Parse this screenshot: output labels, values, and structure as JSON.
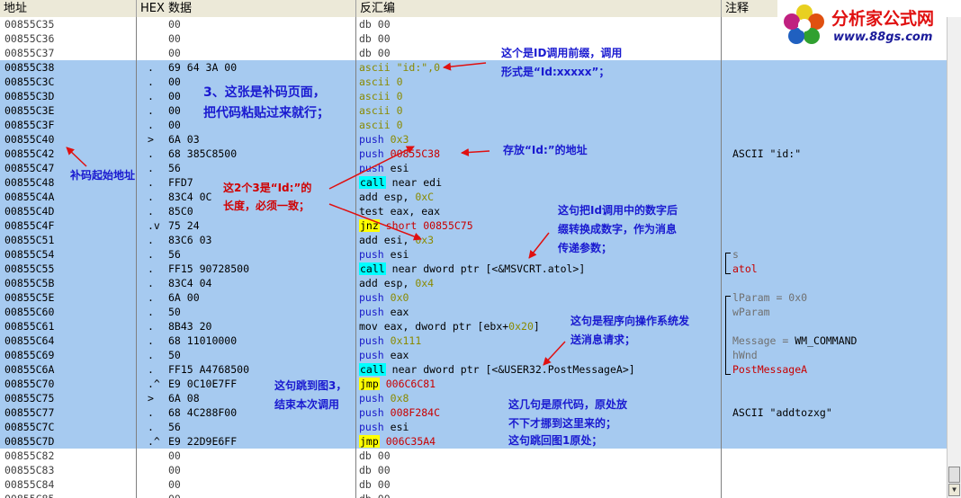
{
  "header": {
    "address": "地址",
    "hex": "HEX 数据",
    "disasm": "反汇编",
    "comment": "注释"
  },
  "logo": {
    "title": "分析家公式网",
    "url": "www.88gs.com"
  },
  "rows": [
    {
      "addr": "00855C35",
      "mark": "",
      "hex": "00",
      "sel": false,
      "dis": [
        {
          "t": "db",
          "c": "db"
        },
        {
          "t": " "
        },
        {
          "t": "00",
          "c": "db"
        }
      ],
      "cmt": []
    },
    {
      "addr": "00855C36",
      "mark": "",
      "hex": "00",
      "sel": false,
      "dis": [
        {
          "t": "db",
          "c": "db"
        },
        {
          "t": " "
        },
        {
          "t": "00",
          "c": "db"
        }
      ],
      "cmt": []
    },
    {
      "addr": "00855C37",
      "mark": "",
      "hex": "00",
      "sel": false,
      "dis": [
        {
          "t": "db",
          "c": "db"
        },
        {
          "t": " "
        },
        {
          "t": "00",
          "c": "db"
        }
      ],
      "cmt": []
    },
    {
      "addr": "00855C38",
      "mark": ".",
      "hex": "69 64 3A 00",
      "sel": true,
      "dis": [
        {
          "t": "ascii",
          "c": "str"
        },
        {
          "t": " "
        },
        {
          "t": "\"id:\",0",
          "c": "str"
        }
      ],
      "cmt": []
    },
    {
      "addr": "00855C3C",
      "mark": ".",
      "hex": "00",
      "sel": true,
      "dis": [
        {
          "t": "ascii",
          "c": "str"
        },
        {
          "t": " "
        },
        {
          "t": "0",
          "c": "str"
        }
      ],
      "cmt": []
    },
    {
      "addr": "00855C3D",
      "mark": ".",
      "hex": "00",
      "sel": true,
      "dis": [
        {
          "t": "ascii",
          "c": "str"
        },
        {
          "t": " "
        },
        {
          "t": "0",
          "c": "str"
        }
      ],
      "cmt": []
    },
    {
      "addr": "00855C3E",
      "mark": ".",
      "hex": "00",
      "sel": true,
      "dis": [
        {
          "t": "ascii",
          "c": "str"
        },
        {
          "t": " "
        },
        {
          "t": "0",
          "c": "str"
        }
      ],
      "cmt": []
    },
    {
      "addr": "00855C3F",
      "mark": ".",
      "hex": "00",
      "sel": true,
      "dis": [
        {
          "t": "ascii",
          "c": "str"
        },
        {
          "t": " "
        },
        {
          "t": "0",
          "c": "str"
        }
      ],
      "cmt": []
    },
    {
      "addr": "00855C40",
      "mark": ">",
      "hex": "6A 03",
      "sel": true,
      "dis": [
        {
          "t": "push",
          "c": "mn"
        },
        {
          "t": " "
        },
        {
          "t": "0x3",
          "c": "im"
        }
      ],
      "cmt": []
    },
    {
      "addr": "00855C42",
      "mark": ".",
      "hex": "68 385C8500",
      "sel": true,
      "dis": [
        {
          "t": "push",
          "c": "mn"
        },
        {
          "t": " "
        },
        {
          "t": "00855C38",
          "c": "ad"
        }
      ],
      "cmt": [
        {
          "t": "ASCII \"id:\"",
          "c": "blk"
        }
      ]
    },
    {
      "addr": "00855C47",
      "mark": ".",
      "hex": "56",
      "sel": true,
      "dis": [
        {
          "t": "push",
          "c": "mn"
        },
        {
          "t": " "
        },
        {
          "t": "esi",
          "c": "op"
        }
      ],
      "cmt": []
    },
    {
      "addr": "00855C48",
      "mark": ".",
      "hex": "FFD7",
      "sel": true,
      "dis": [
        {
          "t": "call",
          "c": "calltag"
        },
        {
          "t": " "
        },
        {
          "t": "near edi",
          "c": "op"
        }
      ],
      "cmt": []
    },
    {
      "addr": "00855C4A",
      "mark": ".",
      "hex": "83C4 0C",
      "sel": true,
      "dis": [
        {
          "t": "add esp, ",
          "c": "op"
        },
        {
          "t": "0xC",
          "c": "im"
        }
      ],
      "cmt": []
    },
    {
      "addr": "00855C4D",
      "mark": ".",
      "hex": "85C0",
      "sel": true,
      "dis": [
        {
          "t": "test eax, eax",
          "c": "op"
        }
      ],
      "cmt": []
    },
    {
      "addr": "00855C4F",
      "mark": ".v",
      "hex": "75 24",
      "sel": true,
      "dis": [
        {
          "t": "jnz",
          "c": "jmptag"
        },
        {
          "t": " "
        },
        {
          "t": "short 00855C75",
          "c": "ad"
        }
      ],
      "cmt": []
    },
    {
      "addr": "00855C51",
      "mark": ".",
      "hex": "83C6 03",
      "sel": true,
      "dis": [
        {
          "t": "add esi, ",
          "c": "op"
        },
        {
          "t": "0x3",
          "c": "im"
        }
      ],
      "cmt": []
    },
    {
      "addr": "00855C54",
      "mark": ".",
      "hex": "56",
      "sel": true,
      "dis": [
        {
          "t": "push",
          "c": "mn"
        },
        {
          "t": " "
        },
        {
          "t": "esi",
          "c": "op"
        }
      ],
      "cmt": [
        {
          "t": "s",
          "c": "gray"
        }
      ]
    },
    {
      "addr": "00855C55",
      "mark": ".",
      "hex": "FF15 90728500",
      "sel": true,
      "dis": [
        {
          "t": "call",
          "c": "calltag"
        },
        {
          "t": " "
        },
        {
          "t": "near dword ptr [<&MSVCRT.atol>]",
          "c": "op"
        }
      ],
      "cmt": [
        {
          "t": "atol",
          "c": "red"
        }
      ]
    },
    {
      "addr": "00855C5B",
      "mark": ".",
      "hex": "83C4 04",
      "sel": true,
      "dis": [
        {
          "t": "add esp, ",
          "c": "op"
        },
        {
          "t": "0x4",
          "c": "im"
        }
      ],
      "cmt": []
    },
    {
      "addr": "00855C5E",
      "mark": ".",
      "hex": "6A 00",
      "sel": true,
      "dis": [
        {
          "t": "push",
          "c": "mn"
        },
        {
          "t": " "
        },
        {
          "t": "0x0",
          "c": "im"
        }
      ],
      "cmt": [
        {
          "t": "lParam = 0x0",
          "c": "gray"
        }
      ]
    },
    {
      "addr": "00855C60",
      "mark": ".",
      "hex": "50",
      "sel": true,
      "dis": [
        {
          "t": "push",
          "c": "mn"
        },
        {
          "t": " "
        },
        {
          "t": "eax",
          "c": "op"
        }
      ],
      "cmt": [
        {
          "t": "wParam",
          "c": "gray"
        }
      ]
    },
    {
      "addr": "00855C61",
      "mark": ".",
      "hex": "8B43 20",
      "sel": true,
      "dis": [
        {
          "t": "mov eax, dword ptr [ebx+",
          "c": "op"
        },
        {
          "t": "0x20",
          "c": "im"
        },
        {
          "t": "]",
          "c": "op"
        }
      ],
      "cmt": []
    },
    {
      "addr": "00855C64",
      "mark": ".",
      "hex": "68 11010000",
      "sel": true,
      "dis": [
        {
          "t": "push",
          "c": "mn"
        },
        {
          "t": " "
        },
        {
          "t": "0x111",
          "c": "im"
        }
      ],
      "cmt": [
        {
          "t": "Message = ",
          "c": "gray"
        },
        {
          "t": "WM_COMMAND",
          "c": "blk"
        }
      ]
    },
    {
      "addr": "00855C69",
      "mark": ".",
      "hex": "50",
      "sel": true,
      "dis": [
        {
          "t": "push",
          "c": "mn"
        },
        {
          "t": " "
        },
        {
          "t": "eax",
          "c": "op"
        }
      ],
      "cmt": [
        {
          "t": "hWnd",
          "c": "gray"
        }
      ]
    },
    {
      "addr": "00855C6A",
      "mark": ".",
      "hex": "FF15 A4768500",
      "sel": true,
      "dis": [
        {
          "t": "call",
          "c": "calltag"
        },
        {
          "t": " "
        },
        {
          "t": "near dword ptr [<&USER32.PostMessageA>]",
          "c": "op"
        }
      ],
      "cmt": [
        {
          "t": "PostMessageA",
          "c": "red"
        }
      ]
    },
    {
      "addr": "00855C70",
      "mark": ".^",
      "hex": "E9 0C10E7FF",
      "sel": true,
      "dis": [
        {
          "t": "jmp",
          "c": "jmptag"
        },
        {
          "t": " "
        },
        {
          "t": "006C6C81",
          "c": "ad"
        }
      ],
      "cmt": []
    },
    {
      "addr": "00855C75",
      "mark": ">",
      "hex": "6A 08",
      "sel": true,
      "dis": [
        {
          "t": "push",
          "c": "mn"
        },
        {
          "t": " "
        },
        {
          "t": "0x8",
          "c": "im"
        }
      ],
      "cmt": []
    },
    {
      "addr": "00855C77",
      "mark": ".",
      "hex": "68 4C288F00",
      "sel": true,
      "dis": [
        {
          "t": "push",
          "c": "mn"
        },
        {
          "t": " "
        },
        {
          "t": "008F284C",
          "c": "ad"
        }
      ],
      "cmt": [
        {
          "t": "ASCII \"addtozxg\"",
          "c": "blk"
        }
      ]
    },
    {
      "addr": "00855C7C",
      "mark": ".",
      "hex": "56",
      "sel": true,
      "dis": [
        {
          "t": "push",
          "c": "mn"
        },
        {
          "t": " "
        },
        {
          "t": "esi",
          "c": "op"
        }
      ],
      "cmt": []
    },
    {
      "addr": "00855C7D",
      "mark": ".^",
      "hex": "E9 22D9E6FF",
      "sel": true,
      "dis": [
        {
          "t": "jmp",
          "c": "jmptag"
        },
        {
          "t": " "
        },
        {
          "t": "006C35A4",
          "c": "ad"
        }
      ],
      "cmt": []
    },
    {
      "addr": "00855C82",
      "mark": "",
      "hex": "00",
      "sel": false,
      "dis": [
        {
          "t": "db",
          "c": "db"
        },
        {
          "t": " "
        },
        {
          "t": "00",
          "c": "db"
        }
      ],
      "cmt": []
    },
    {
      "addr": "00855C83",
      "mark": "",
      "hex": "00",
      "sel": false,
      "dis": [
        {
          "t": "db",
          "c": "db"
        },
        {
          "t": " "
        },
        {
          "t": "00",
          "c": "db"
        }
      ],
      "cmt": []
    },
    {
      "addr": "00855C84",
      "mark": "",
      "hex": "00",
      "sel": false,
      "dis": [
        {
          "t": "db",
          "c": "db"
        },
        {
          "t": " "
        },
        {
          "t": "00",
          "c": "db"
        }
      ],
      "cmt": []
    },
    {
      "addr": "00855C85",
      "mark": "",
      "hex": "00",
      "sel": false,
      "dis": [
        {
          "t": "db",
          "c": "db"
        },
        {
          "t": " "
        },
        {
          "t": "00",
          "c": "db"
        }
      ],
      "cmt": []
    }
  ],
  "annotations": {
    "id_prefix_1": "这个是ID调用前缀，调用",
    "id_prefix_2": "形式是“Id:xxxxx”；",
    "patch_page_1": "3、这张是补码页面，",
    "patch_page_2": "把代码粘贴过来就行；",
    "store_addr": "存放“Id:”的地址",
    "patch_start": "补码起始地址",
    "len_note_1": "这2个3是“Id:”的",
    "len_note_2": "长度，必须一致；",
    "atol_note_1": "这句把Id调用中的数字后",
    "atol_note_2": "缀转换成数字，作为消息",
    "atol_note_3": "传递参数；",
    "post_note_1": "这句是程序向操作系统发",
    "post_note_2": "送消息请求；",
    "jump3_note_1": "这句跳到图3，",
    "jump3_note_2": "结束本次调用",
    "orig_note_1": "这几句是原代码，原处放",
    "orig_note_2": "不下才挪到这里来的；",
    "orig_note_3": "这句跳回图1原处；"
  },
  "colors": {
    "selection": "#a6caf0",
    "annotation_blue": "#1a1ad0",
    "annotation_red": "#d00000",
    "call_highlight": "#00ffff",
    "jump_highlight": "#ffff00"
  }
}
